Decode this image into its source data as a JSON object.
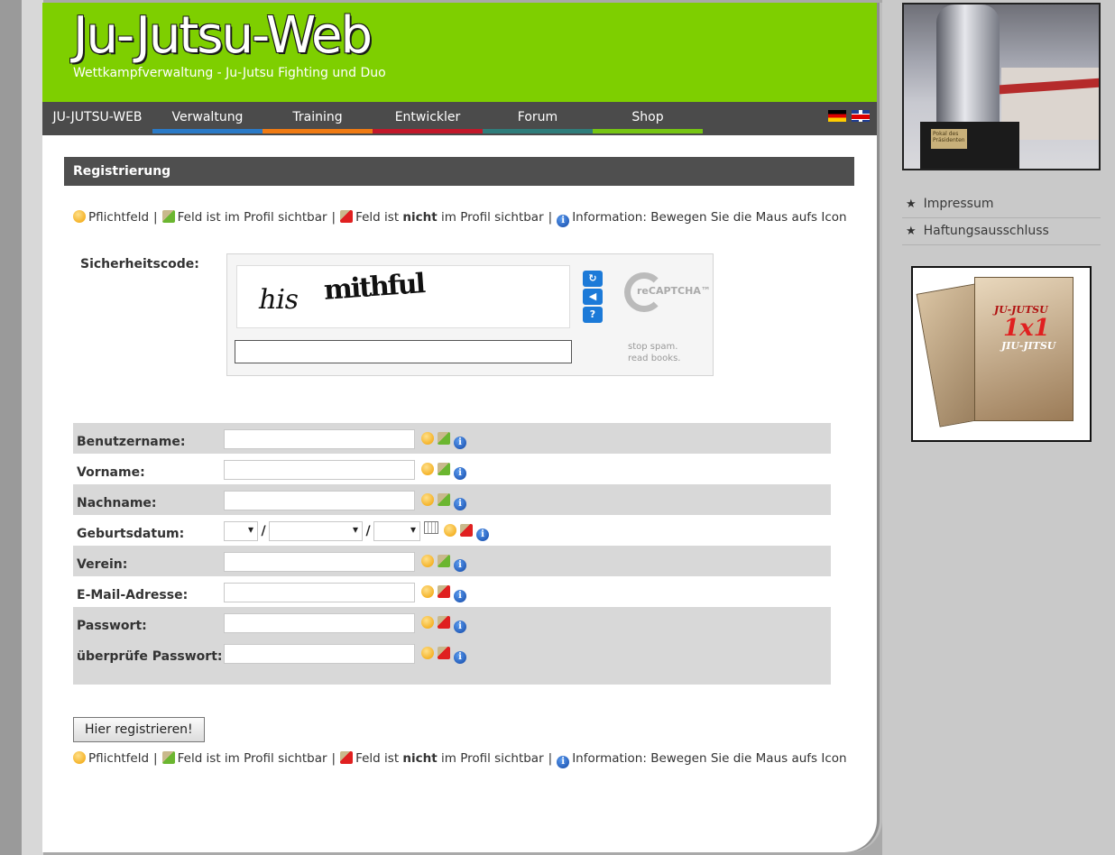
{
  "site": {
    "title": "Ju-Jutsu-Web",
    "tagline": "Wettkampfverwaltung - Ju-Jutsu Fighting und Duo"
  },
  "nav": [
    {
      "label": "JU-JUTSU-WEB",
      "color": "#4b4b4b"
    },
    {
      "label": "Verwaltung",
      "color": "#2a7ac7"
    },
    {
      "label": "Training",
      "color": "#f07b13"
    },
    {
      "label": "Entwickler",
      "color": "#c2182a"
    },
    {
      "label": "Forum",
      "color": "#2f7d7b"
    },
    {
      "label": "Shop",
      "color": "#76c513"
    }
  ],
  "languages": [
    "de",
    "en"
  ],
  "section": {
    "title": "Registrierung"
  },
  "legend": {
    "required": "Pflichtfeld",
    "visible": "Feld ist im Profil sichtbar",
    "not_visible_prefix": "Feld ist",
    "not_visible_bold": "nicht",
    "not_visible_suffix": "im Profil sichtbar",
    "info": "Information: Bewegen Sie die Maus aufs Icon",
    "separator": "|"
  },
  "captcha": {
    "label": "Sicherheitscode:",
    "word1": "his",
    "word2": "mithful",
    "logo_text": "reCAPTCHA™",
    "tagline_1": "stop spam.",
    "tagline_2": "read books.",
    "refresh_icon": "refresh-icon",
    "audio_icon": "audio-icon",
    "help_icon": "help-icon"
  },
  "form": {
    "fields": [
      {
        "label": "Benutzername:",
        "value": "",
        "visible": true
      },
      {
        "label": "Vorname:",
        "value": "",
        "visible": true
      },
      {
        "label": "Nachname:",
        "value": "",
        "visible": true
      },
      {
        "label": "Geburtsdatum:",
        "value": "",
        "visible": false
      },
      {
        "label": "Verein:",
        "value": "",
        "visible": true
      },
      {
        "label": "E-Mail-Adresse:",
        "value": "",
        "visible": false
      },
      {
        "label": "Passwort:",
        "value": "",
        "visible": false
      },
      {
        "label": "überprüfe Passwort:",
        "value": "",
        "visible": false
      }
    ],
    "date_separator": "/",
    "submit_label": "Hier registrieren!"
  },
  "sidebar": {
    "links": [
      "Impressum",
      "Haftungsausschluss"
    ],
    "book": {
      "title_1": "JU-JUTSU",
      "title_2": "1x1",
      "title_3": "JIU-JITSU"
    },
    "trophy_plate": "Pokal des Präsidenten"
  }
}
